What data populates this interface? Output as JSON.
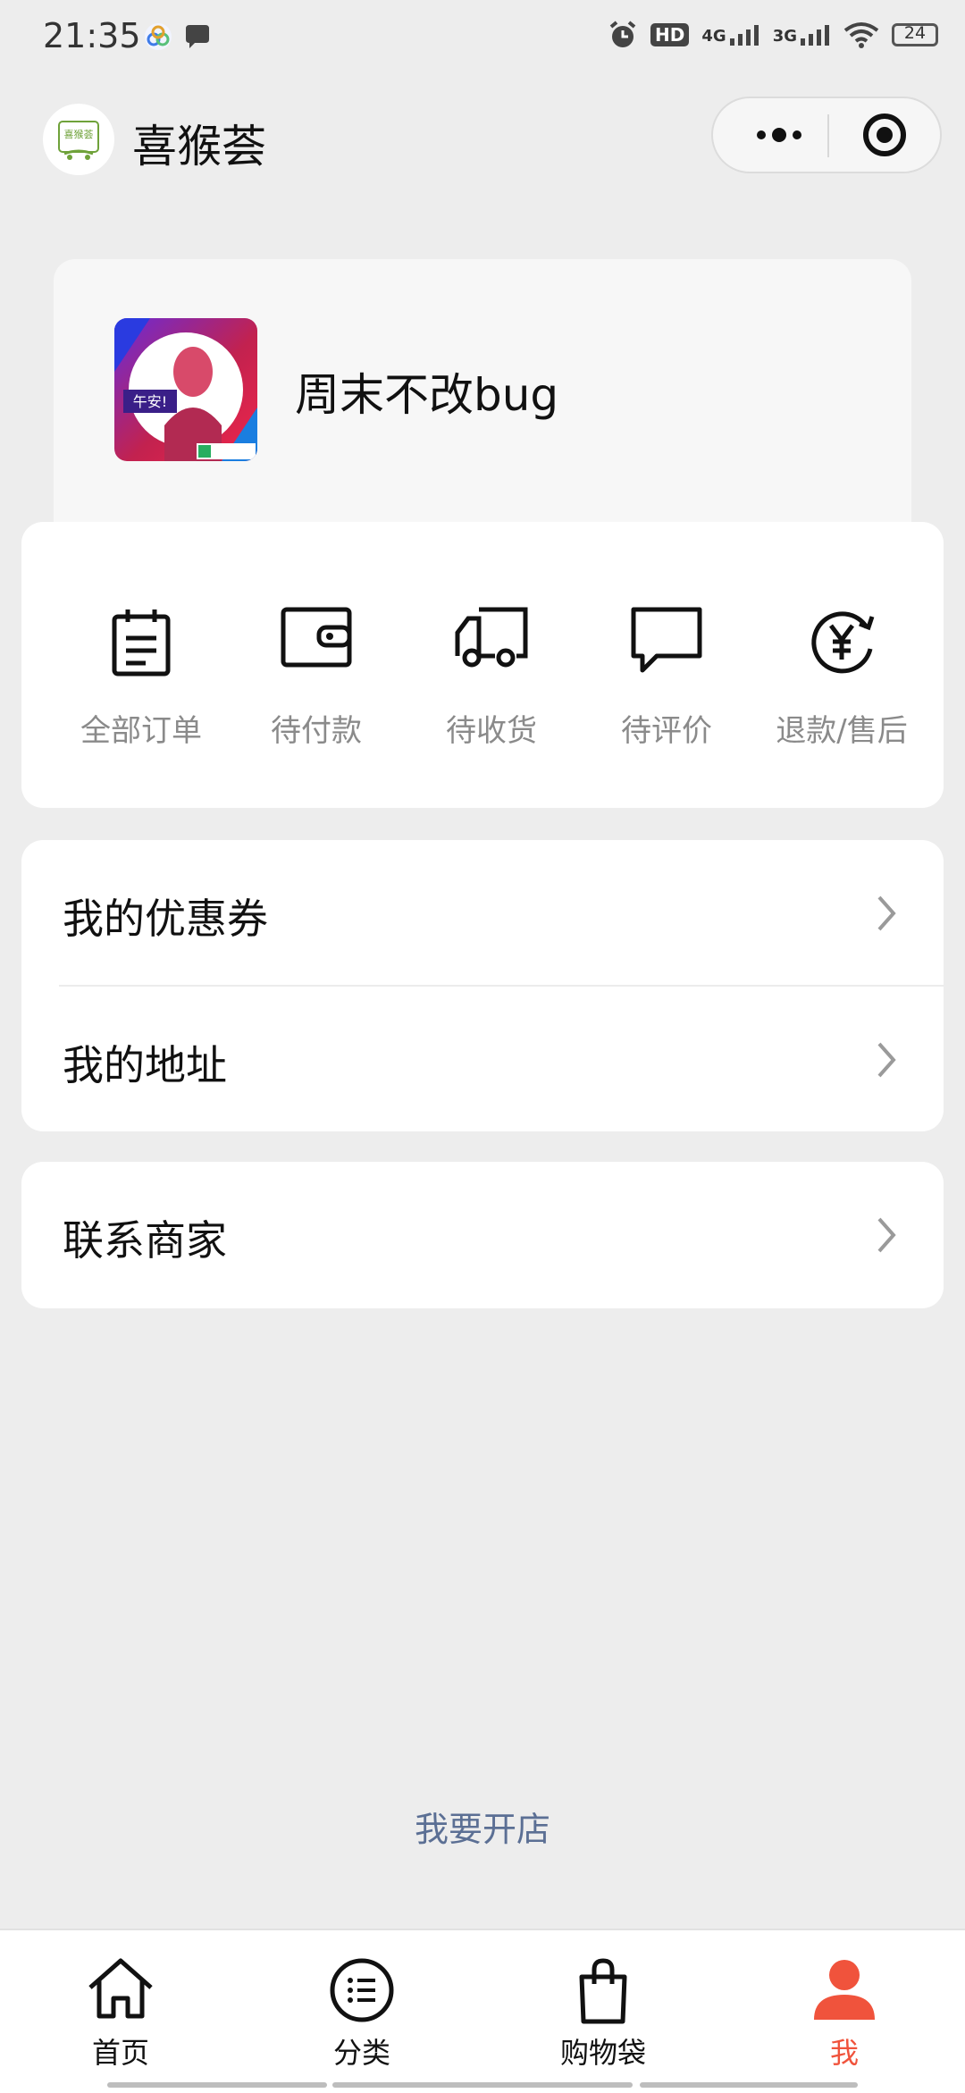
{
  "status_bar": {
    "time": "21:35",
    "battery": "24",
    "network_1": "4G",
    "network_2": "3G",
    "hd": "HD"
  },
  "header": {
    "title": "喜猴荟",
    "logo_text": "喜猴荟"
  },
  "profile": {
    "username": "周末不改bug",
    "avatar_caption": "午安!"
  },
  "orders": [
    {
      "label": "全部订单",
      "icon": "clipboard-icon"
    },
    {
      "label": "待付款",
      "icon": "wallet-icon"
    },
    {
      "label": "待收货",
      "icon": "truck-icon"
    },
    {
      "label": "待评价",
      "icon": "comment-icon"
    },
    {
      "label": "退款/售后",
      "icon": "refund-yuan-icon"
    }
  ],
  "menu": {
    "coupons": "我的优惠券",
    "address": "我的地址",
    "contact": "联系商家"
  },
  "open_store": "我要开店",
  "tabs": [
    {
      "label": "首页",
      "icon": "home-icon"
    },
    {
      "label": "分类",
      "icon": "category-list-icon"
    },
    {
      "label": "购物袋",
      "icon": "shopping-bag-icon"
    },
    {
      "label": "我",
      "icon": "person-icon",
      "active": true
    }
  ],
  "colors": {
    "accent": "#f0533c",
    "link": "#5b6f94",
    "background": "#ededed"
  }
}
